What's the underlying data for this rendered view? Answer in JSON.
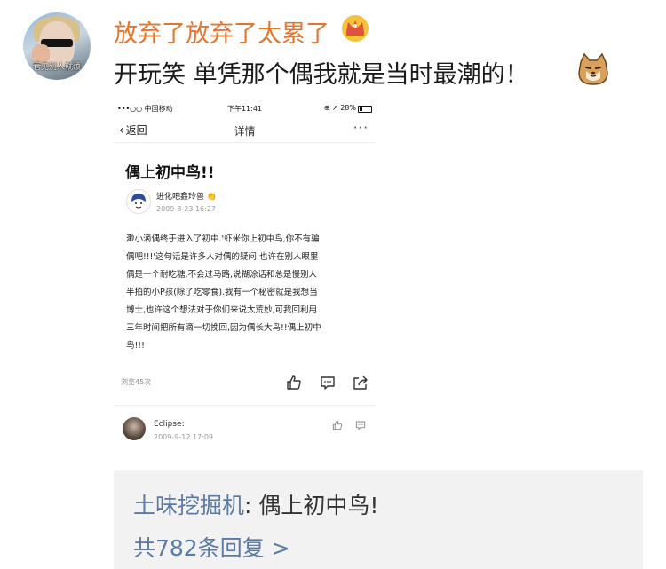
{
  "post": {
    "username": "放弃了放弃了太累了",
    "text": "开玩笑 单凭那个偶我就是当时最潮的！",
    "avatar_caption": "看见别人就烦"
  },
  "screenshot": {
    "status_bar": {
      "carrier": "•••○○ 中国移动 ",
      "time": "下午11:41",
      "right": "⊕ ↗ 28%"
    },
    "nav": {
      "back_label": "返回",
      "title": "详情",
      "more": "···"
    },
    "article": {
      "title": "偶上初中鸟!!",
      "author": "进化吧鑫玲兽",
      "time": "2009-8-23 16:27",
      "lines": [
        "渺小滴偶终于进入了初中.'虾米你上初中鸟,你不有骗",
        "偶吧!!!'这句话是许多人对偶的疑问,也许在别人眼里",
        "偶是一个耐吃糖,不会过马路,说糊涂话和总是慢别人",
        "半拍的小P孩(除了吃零食).我有一个秘密就是我想当",
        "博士,也许这个想法对于你们来说太荒妙,可我回利用",
        "三年时间把所有滴一切挽回,因为偶长大鸟!!偶上初中",
        "鸟!!!"
      ],
      "views": "浏览45次"
    },
    "comment": {
      "name": "Eclipse:",
      "time": "2009-9-12 17:09"
    }
  },
  "share": {
    "user": "土味挖掘机",
    "separator": ": ",
    "title": "偶上初中鸟!",
    "replies": "共782条回复 >"
  },
  "icons": [
    "crown-icon",
    "cat-icon",
    "back-chevron-icon",
    "more-icon",
    "like-icon",
    "comment-icon",
    "share-icon"
  ],
  "colors": {
    "username": "#e8742a",
    "link": "#5b7ba6",
    "share_bg": "#f2f2f2"
  }
}
